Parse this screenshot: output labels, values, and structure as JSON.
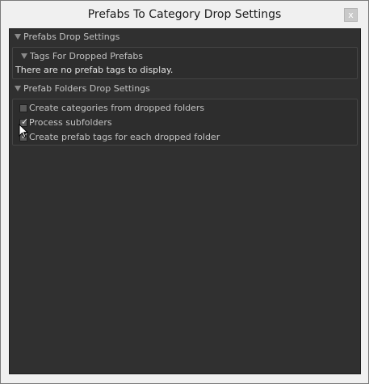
{
  "window": {
    "title": "Prefabs To Category Drop Settings",
    "close_label": "x"
  },
  "prefabs_drop": {
    "header": "Prefabs Drop Settings",
    "expanded": true,
    "tags_section": {
      "header": "Tags For Dropped Prefabs",
      "expanded": true,
      "empty_message": "There are no prefab tags to display."
    }
  },
  "folders_drop": {
    "header": "Prefab Folders Drop Settings",
    "expanded": true,
    "toggles": [
      {
        "label": "Create categories from dropped folders",
        "checked": false
      },
      {
        "label": "Process subfolders",
        "checked": true
      },
      {
        "label": "Create prefab tags for each dropped folder",
        "checked": true
      }
    ]
  },
  "icons": {
    "foldout": "foldout-triangle-icon",
    "check": "checkmark-icon",
    "cursor": "mouse-pointer-icon"
  }
}
